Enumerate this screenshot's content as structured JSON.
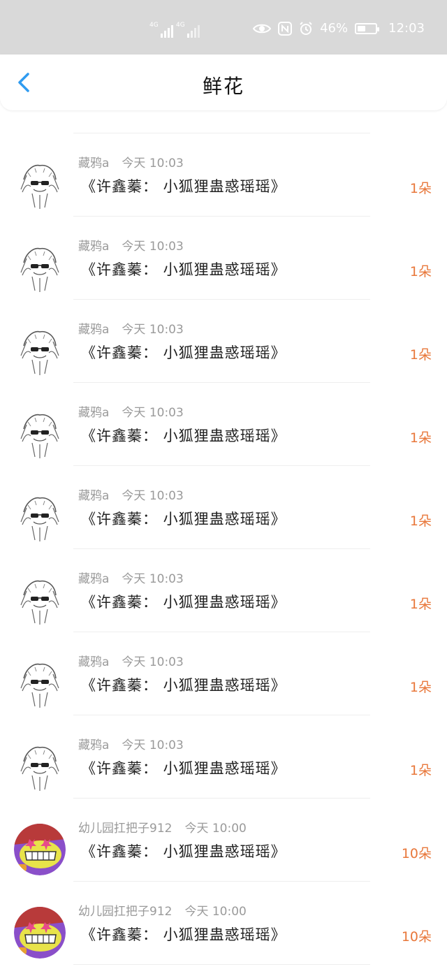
{
  "status_bar": {
    "signal_1_tag": "4G",
    "signal_2_tag": "4G",
    "battery_percent": "46%",
    "battery_level": 0.46,
    "time": "12:03"
  },
  "header": {
    "title": "鲜花"
  },
  "list": [
    {
      "user": "藏鸦a",
      "time": "今天 10:03",
      "work": "《许鑫蓁： 小狐狸蛊惑瑶瑶》",
      "count": "1朵",
      "avatar": "sketch-avatar"
    },
    {
      "user": "藏鸦a",
      "time": "今天 10:03",
      "work": "《许鑫蓁： 小狐狸蛊惑瑶瑶》",
      "count": "1朵",
      "avatar": "sketch-avatar"
    },
    {
      "user": "藏鸦a",
      "time": "今天 10:03",
      "work": "《许鑫蓁： 小狐狸蛊惑瑶瑶》",
      "count": "1朵",
      "avatar": "sketch-avatar"
    },
    {
      "user": "藏鸦a",
      "time": "今天 10:03",
      "work": "《许鑫蓁： 小狐狸蛊惑瑶瑶》",
      "count": "1朵",
      "avatar": "sketch-avatar"
    },
    {
      "user": "藏鸦a",
      "time": "今天 10:03",
      "work": "《许鑫蓁： 小狐狸蛊惑瑶瑶》",
      "count": "1朵",
      "avatar": "sketch-avatar"
    },
    {
      "user": "藏鸦a",
      "time": "今天 10:03",
      "work": "《许鑫蓁： 小狐狸蛊惑瑶瑶》",
      "count": "1朵",
      "avatar": "sketch-avatar"
    },
    {
      "user": "藏鸦a",
      "time": "今天 10:03",
      "work": "《许鑫蓁： 小狐狸蛊惑瑶瑶》",
      "count": "1朵",
      "avatar": "sketch-avatar"
    },
    {
      "user": "藏鸦a",
      "time": "今天 10:03",
      "work": "《许鑫蓁： 小狐狸蛊惑瑶瑶》",
      "count": "1朵",
      "avatar": "sketch-avatar"
    },
    {
      "user": "幼儿园扛把子912",
      "time": "今天 10:00",
      "work": "《许鑫蓁： 小狐狸蛊惑瑶瑶》",
      "count": "10朵",
      "avatar": "cartoon-avatar"
    },
    {
      "user": "幼儿园扛把子912",
      "time": "今天 10:00",
      "work": "《许鑫蓁： 小狐狸蛊惑瑶瑶》",
      "count": "10朵",
      "avatar": "cartoon-avatar"
    }
  ],
  "colors": {
    "accent_blue": "#2f9bf0",
    "count_orange": "#e8773a",
    "meta_gray": "#9a9a9a",
    "status_bar_bg": "#d9d9d9"
  }
}
